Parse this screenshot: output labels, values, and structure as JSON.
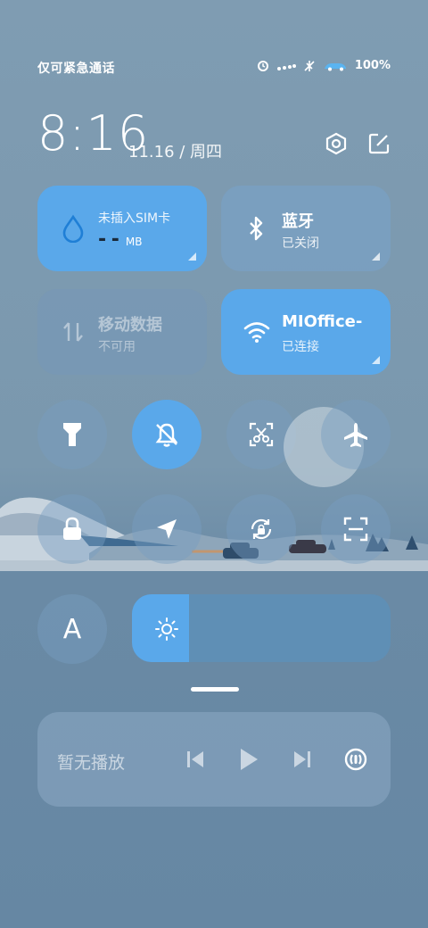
{
  "status_bar": {
    "carrier_text": "仅可紧急通话",
    "battery_label": "100",
    "battery_percent": 100
  },
  "header": {
    "time": "8:16",
    "date": "11.16 / 周四"
  },
  "tiles": {
    "data_usage": {
      "title": "未插入SIM卡",
      "value": "- -",
      "unit": "MB"
    },
    "bluetooth": {
      "title": "蓝牙",
      "status": "已关闭"
    },
    "mobile_data": {
      "title": "移动数据",
      "status": "不可用"
    },
    "wifi": {
      "title": "MIOffice-",
      "status": "已连接"
    }
  },
  "toggles_row1": [
    {
      "icon": "flashlight-icon",
      "active": false
    },
    {
      "icon": "mute-bell-icon",
      "active": true
    },
    {
      "icon": "screenshot-icon",
      "active": false
    },
    {
      "icon": "airplane-icon",
      "active": false
    }
  ],
  "toggles_row2": [
    {
      "icon": "lock-icon",
      "active": false
    },
    {
      "icon": "location-icon",
      "active": false
    },
    {
      "icon": "rotation-lock-icon",
      "active": false
    },
    {
      "icon": "scan-icon",
      "active": false
    }
  ],
  "brightness": {
    "auto_label": "A",
    "level": 0.22
  },
  "media": {
    "label": "暂无播放"
  },
  "colors": {
    "accent": "#5aa8ea",
    "tile_inactive": "#7aa0c4",
    "background": "#7f9cb2"
  }
}
